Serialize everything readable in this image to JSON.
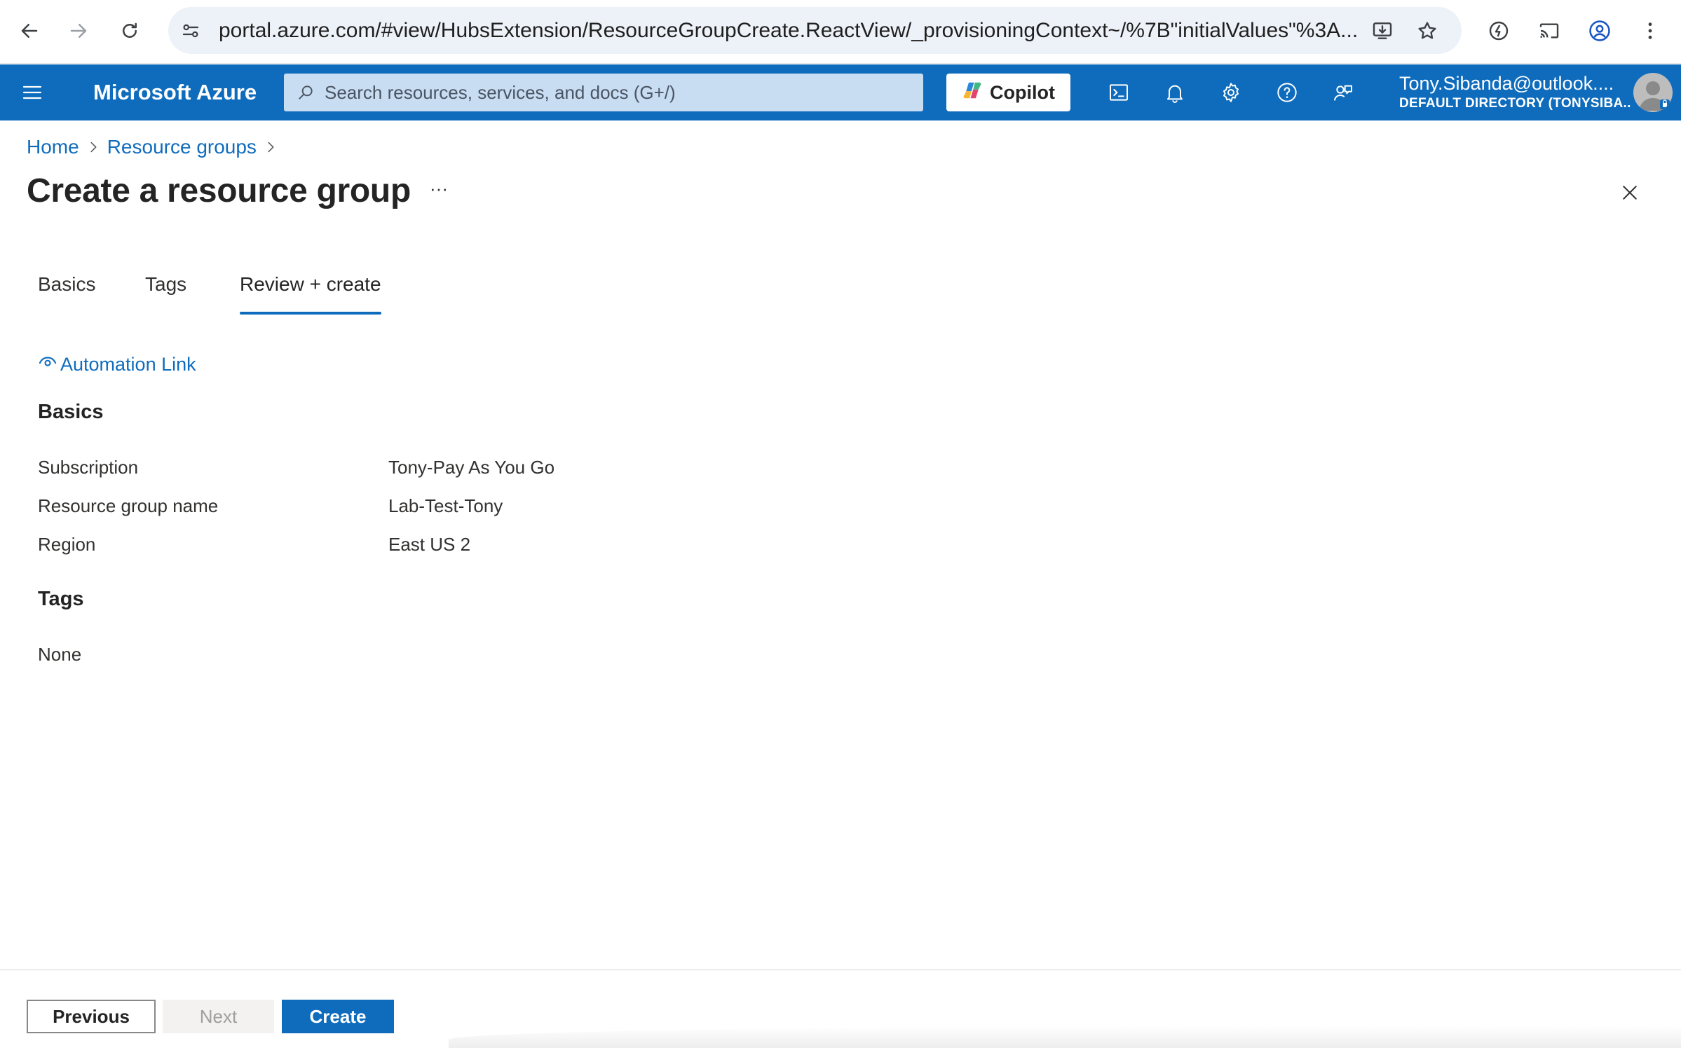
{
  "browser": {
    "url": "portal.azure.com/#view/HubsExtension/ResourceGroupCreate.ReactView/_provisioningContext~/%7B\"initialValues\"%3A..."
  },
  "header": {
    "brand": "Microsoft Azure",
    "search_placeholder": "Search resources, services, and docs (G+/)",
    "copilot_label": "Copilot",
    "account_name": "Tony.Sibanda@outlook....",
    "account_directory": "DEFAULT DIRECTORY (TONYSIBA..."
  },
  "breadcrumb": {
    "home": "Home",
    "resource_groups": "Resource groups"
  },
  "page": {
    "title": "Create a resource group",
    "more": "···"
  },
  "tabs": [
    {
      "label": "Basics",
      "active": false
    },
    {
      "label": "Tags",
      "active": false
    },
    {
      "label": "Review + create",
      "active": true
    }
  ],
  "automation_link": "Automation Link",
  "basics": {
    "heading": "Basics",
    "rows": [
      {
        "label": "Subscription",
        "value": "Tony-Pay As You Go"
      },
      {
        "label": "Resource group name",
        "value": "Lab-Test-Tony"
      },
      {
        "label": "Region",
        "value": "East US 2"
      }
    ]
  },
  "tags": {
    "heading": "Tags",
    "value": "None"
  },
  "footer": {
    "previous": "Previous",
    "next": "Next",
    "create": "Create"
  },
  "colors": {
    "azure_blue": "#0f6cbd",
    "search_bg": "#c8dcf2"
  }
}
